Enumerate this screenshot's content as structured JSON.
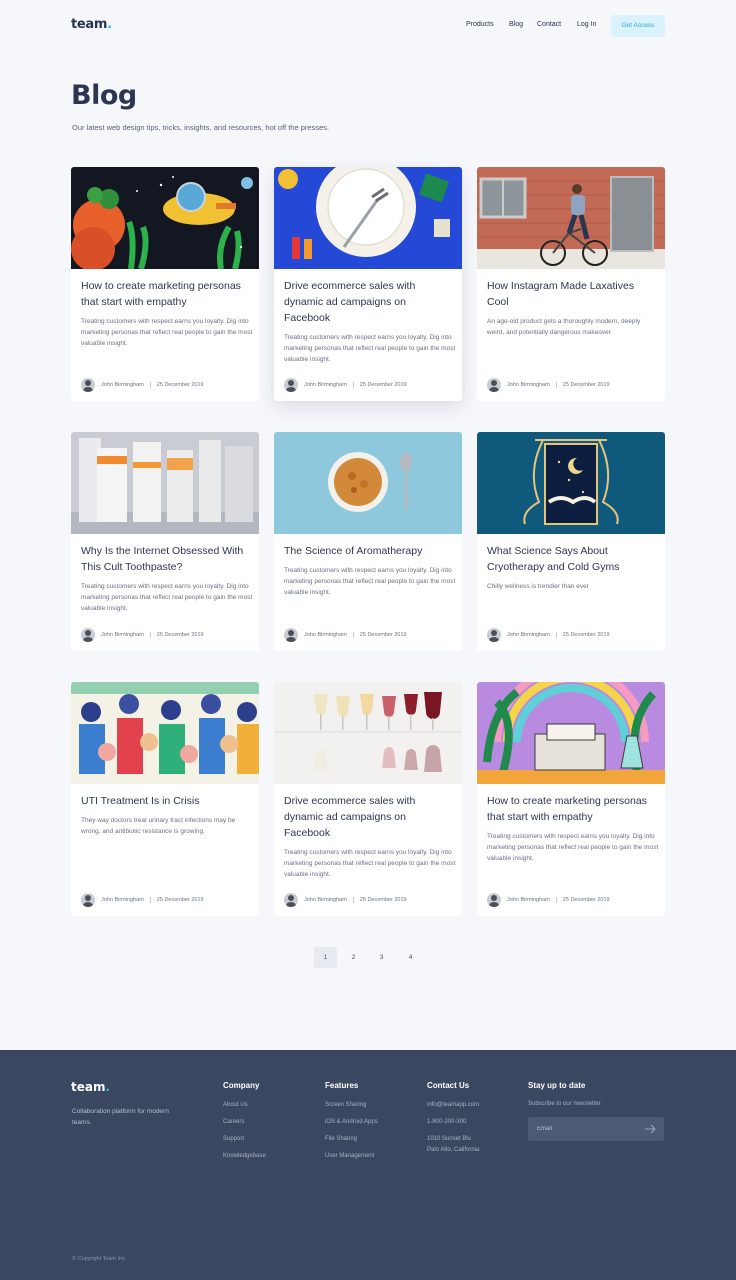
{
  "header": {
    "logo_text": "team",
    "logo_dot": ".",
    "nav": [
      "Products",
      "Blog",
      "Contact",
      "Log In"
    ],
    "cta_label": "Get Access"
  },
  "page": {
    "title": "Blog",
    "subtitle": "Our latest web design tips, tricks, insights, and resources, hot off the presses."
  },
  "posts": [
    {
      "title": "How to create marketing personas that start with empathy",
      "excerpt": "Treating customers with respect earns you loyalty. Dig into marketing personas that reflect real people to gain the most valuable insight.",
      "author": "John Birmingham",
      "date": "25 December 2019",
      "image": "underwater-scene"
    },
    {
      "title": "Drive ecommerce sales with dynamic ad campaigns on Facebook",
      "excerpt": "Treating customers with respect earns you loyalty. Dig into marketing personas that reflect real people to gain the most valuable insight.",
      "author": "John Birmingham",
      "date": "25 December 2019",
      "image": "plate-and-fork"
    },
    {
      "title": "How Instagram Made Laxatives Cool",
      "excerpt": "An age-old product gets a thoroughly modern, deeply weird, and potentially dangerous makeover",
      "author": "John Birmingham",
      "date": "25 December 2019",
      "image": "cyclist-brick-wall"
    },
    {
      "title": "Why Is the Internet Obsessed With This Cult Toothpaste?",
      "excerpt": "Treating customers with respect earns you loyalty. Dig into marketing personas that reflect real people to gain the most valuable insight.",
      "author": "John Birmingham",
      "date": "25 December 2019",
      "image": "product-bottles"
    },
    {
      "title": "The Science of Aromatherapy",
      "excerpt": "Treating customers with respect earns you loyalty. Dig into marketing personas that reflect real people to gain the most valuable insight.",
      "author": "John Birmingham",
      "date": "25 December 2019",
      "image": "cereal-bowl"
    },
    {
      "title": "What Science Says About Cryotherapy and Cold Gyms",
      "excerpt": "Chilly wellness is trendier than ever",
      "author": "John Birmingham",
      "date": "25 December 2019",
      "image": "night-window"
    },
    {
      "title": "UTI Treatment Is in Crisis",
      "excerpt": "They way doctors treat urinary tract infections may be wrong, and antibiotic resistance is growing.",
      "author": "John Birmingham",
      "date": "25 December 2019",
      "image": "crowd-illustration"
    },
    {
      "title": "Drive ecommerce sales with dynamic ad campaigns on Facebook",
      "excerpt": "Treating customers with respect earns you loyalty. Dig into marketing personas that reflect real people to gain the most valuable insight.",
      "author": "John Birmingham",
      "date": "25 December 2019",
      "image": "wine-glasses"
    },
    {
      "title": "How to create marketing personas that start with empathy",
      "excerpt": "Treating customers with respect earns you loyalty. Dig into marketing personas that reflect real people to gain the most valuable insight.",
      "author": "John Birmingham",
      "date": "25 December 2019",
      "image": "lab-illustration"
    }
  ],
  "pagination": {
    "pages": [
      "1",
      "2",
      "3",
      "4"
    ],
    "current": "1"
  },
  "footer": {
    "logo_text": "team",
    "logo_dot": ".",
    "tagline": "Collaboration platform for modern teams.",
    "columns": [
      {
        "title": "Company",
        "links": [
          "About Us",
          "Careers",
          "Support",
          "Knowledgebase"
        ]
      },
      {
        "title": "Features",
        "links": [
          "Screen Sharing",
          "iOS & Android Apps",
          "File Sharing",
          "User Management"
        ]
      },
      {
        "title": "Contact Us",
        "links": [
          "info@teamapp.com",
          "1-800-200-300",
          "1010 Sunset Blv.",
          "Palo Alto, California"
        ]
      }
    ],
    "newsletter": {
      "title": "Stay up to date",
      "subtitle": "Subscribe to our newsletter",
      "placeholder": "Email",
      "submit_icon": "arrow-right-icon"
    },
    "copyright": "© Copyright Team Inc."
  },
  "colors": {
    "accent": "#29c0ea",
    "text_dark": "#2d3650",
    "footer_bg": "#3a4760",
    "page_bg": "#f5f7fb"
  }
}
